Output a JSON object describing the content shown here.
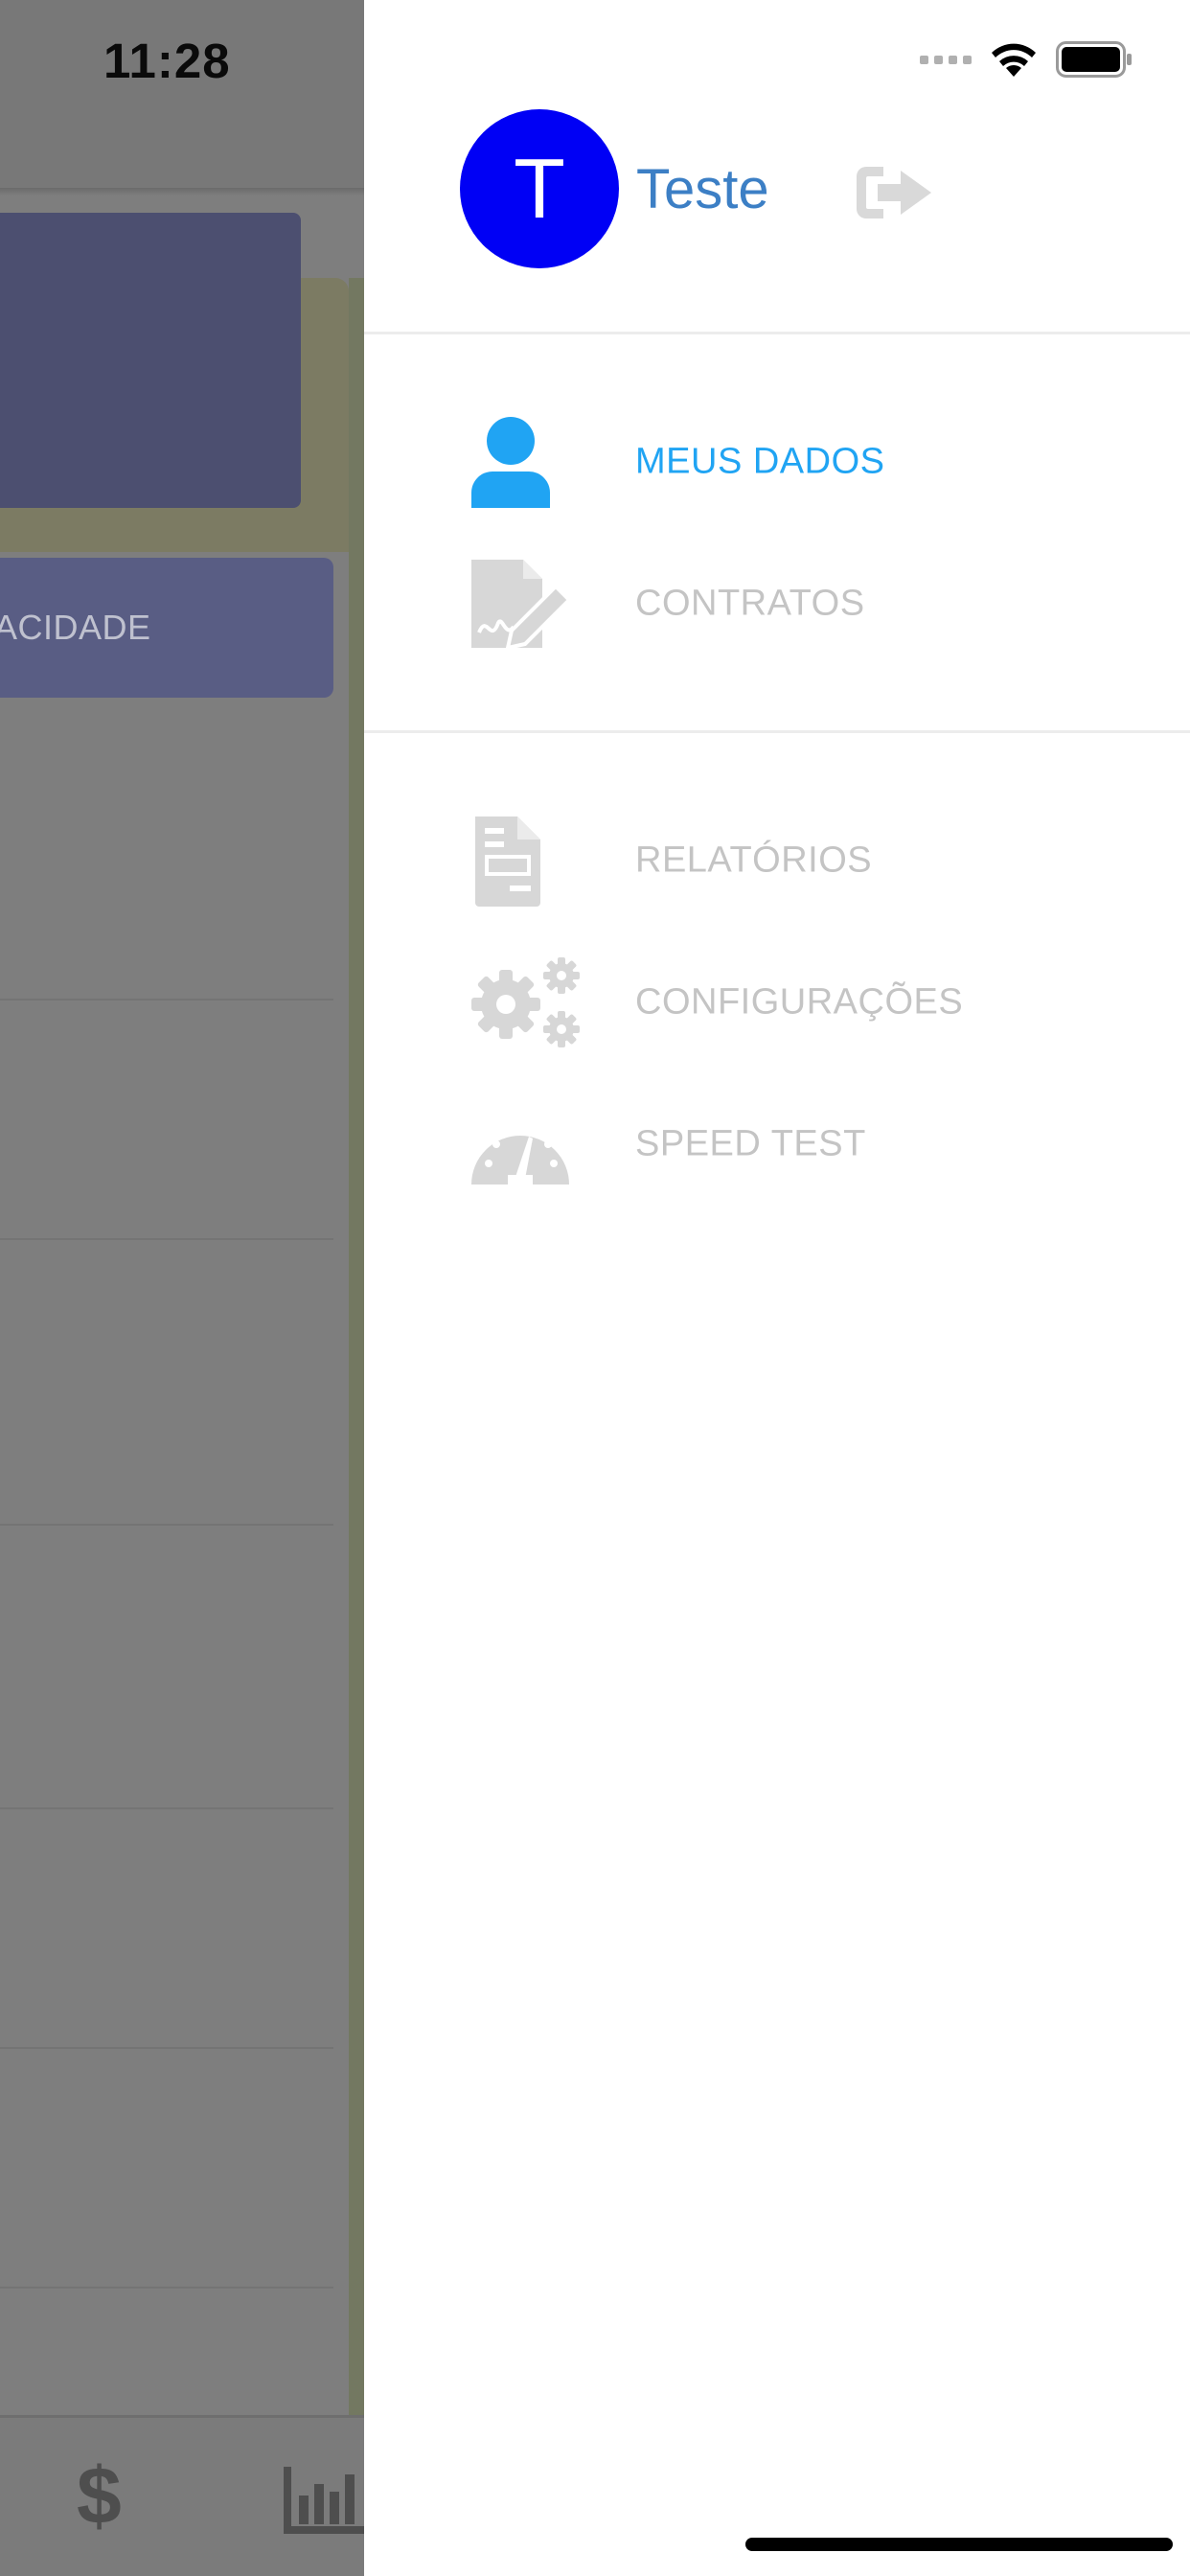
{
  "status_bar": {
    "time": "11:28"
  },
  "background": {
    "privacy_button_label": "ACIDADE",
    "tab_icons": [
      "dollar-icon",
      "bar-chart-icon"
    ]
  },
  "drawer": {
    "user": {
      "initial": "T",
      "name": "Teste"
    },
    "menu_sections": [
      [
        {
          "label": "MEUS DADOS",
          "icon": "user-icon",
          "active": true
        },
        {
          "label": "CONTRATOS",
          "icon": "contract-sign-icon",
          "active": false
        }
      ],
      [
        {
          "label": "RELATÓRIOS",
          "icon": "report-icon",
          "active": false
        },
        {
          "label": "CONFIGURAÇÕES",
          "icon": "gears-icon",
          "active": false
        },
        {
          "label": "SPEED TEST",
          "icon": "speedometer-icon",
          "active": false
        }
      ]
    ]
  },
  "colors": {
    "active": "#20a4f3",
    "inactive": "#c4c4c4",
    "avatar": "#0000f5",
    "user_name": "#3c7fc5"
  }
}
